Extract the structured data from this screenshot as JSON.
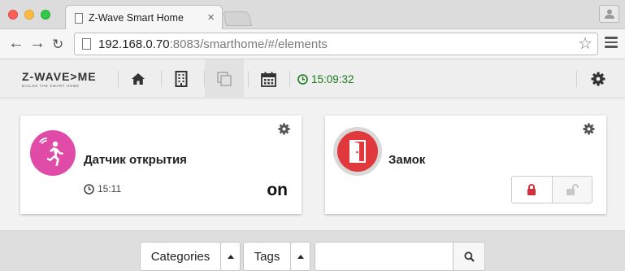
{
  "browser": {
    "tab_title": "Z-Wave Smart Home",
    "tab_close": "×",
    "url_host": "192.168.0.70",
    "url_rest": ":8083/smarthome/#/elements",
    "star": "☆"
  },
  "app": {
    "logo": "Z-WAVE>ME",
    "logo_sub": "BUILDS THE SMART HOME",
    "clock": "15:09:32",
    "colors": {
      "clock_green": "#1a7a1a",
      "motion_pink": "#e04ba7",
      "lock_red": "#e0383c"
    },
    "nav_icons": [
      "home-icon",
      "rooms-icon",
      "elements-icon",
      "events-icon",
      "settings-icon"
    ]
  },
  "widgets": [
    {
      "title": "Датчик открытия",
      "time": "15:11",
      "level": "on",
      "icon": "motion-sensor-icon"
    },
    {
      "title": "Замок",
      "icon": "door-lock-icon",
      "controls": [
        "lock-closed-icon",
        "lock-open-icon"
      ]
    }
  ],
  "filters": {
    "categories_label": "Categories",
    "tags_label": "Tags",
    "search_value": ""
  }
}
